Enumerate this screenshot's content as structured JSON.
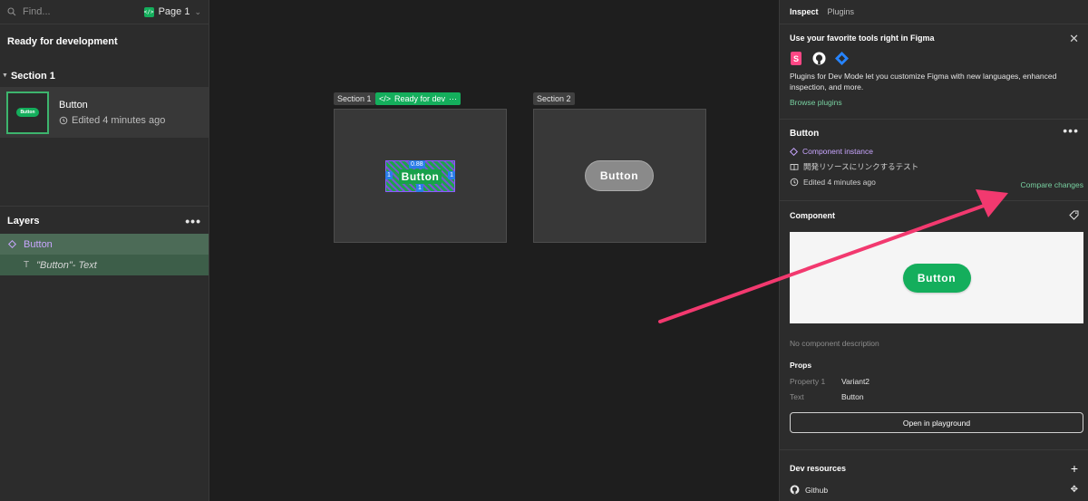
{
  "left": {
    "search": {
      "placeholder": "Find..."
    },
    "page_selector": {
      "label": "Page 1"
    },
    "ready_title": "Ready for development",
    "section_label": "Section 1",
    "item": {
      "name": "Button",
      "edited": "Edited 4 minutes ago",
      "thumb_label": "Button"
    },
    "layers_title": "Layers",
    "layers": [
      {
        "label": "Button",
        "icon": "component-instance-icon"
      },
      {
        "label": "\"Button\"- Text",
        "icon": "text-icon"
      }
    ]
  },
  "canvas": {
    "section1": {
      "label": "Section 1",
      "tag": "Ready for dev",
      "button_label": "Button",
      "measurements": {
        "top": "0.88",
        "left": "1",
        "right": "1",
        "bottom": "1"
      }
    },
    "section2": {
      "label": "Section 2",
      "button_label": "Button"
    }
  },
  "right": {
    "tabs": [
      "Inspect",
      "Plugins"
    ],
    "promo": {
      "title": "Use your favorite tools right in Figma",
      "description": "Plugins for Dev Mode let you customize Figma with new languages, enhanced inspection, and more.",
      "link": "Browse plugins"
    },
    "instance": {
      "title": "Button",
      "type": "Component instance",
      "doc_text": "開発リソースにリンクするテスト",
      "edited": "Edited 4 minutes ago",
      "compare": "Compare changes"
    },
    "component": {
      "title": "Component",
      "preview_label": "Button",
      "no_description": "No component description"
    },
    "props": {
      "title": "Props",
      "rows": [
        {
          "key": "Property 1",
          "value": "Variant2"
        },
        {
          "key": "Text",
          "value": "Button"
        }
      ],
      "playground": "Open in playground"
    },
    "dev_resources": {
      "title": "Dev resources",
      "items": [
        {
          "label": "Github"
        }
      ]
    }
  },
  "colors": {
    "accent_green": "#14ae5c",
    "instance_purple": "#c9a6ff",
    "annotation_arrow": "#f2396f",
    "link_green": "#78d0a0"
  }
}
